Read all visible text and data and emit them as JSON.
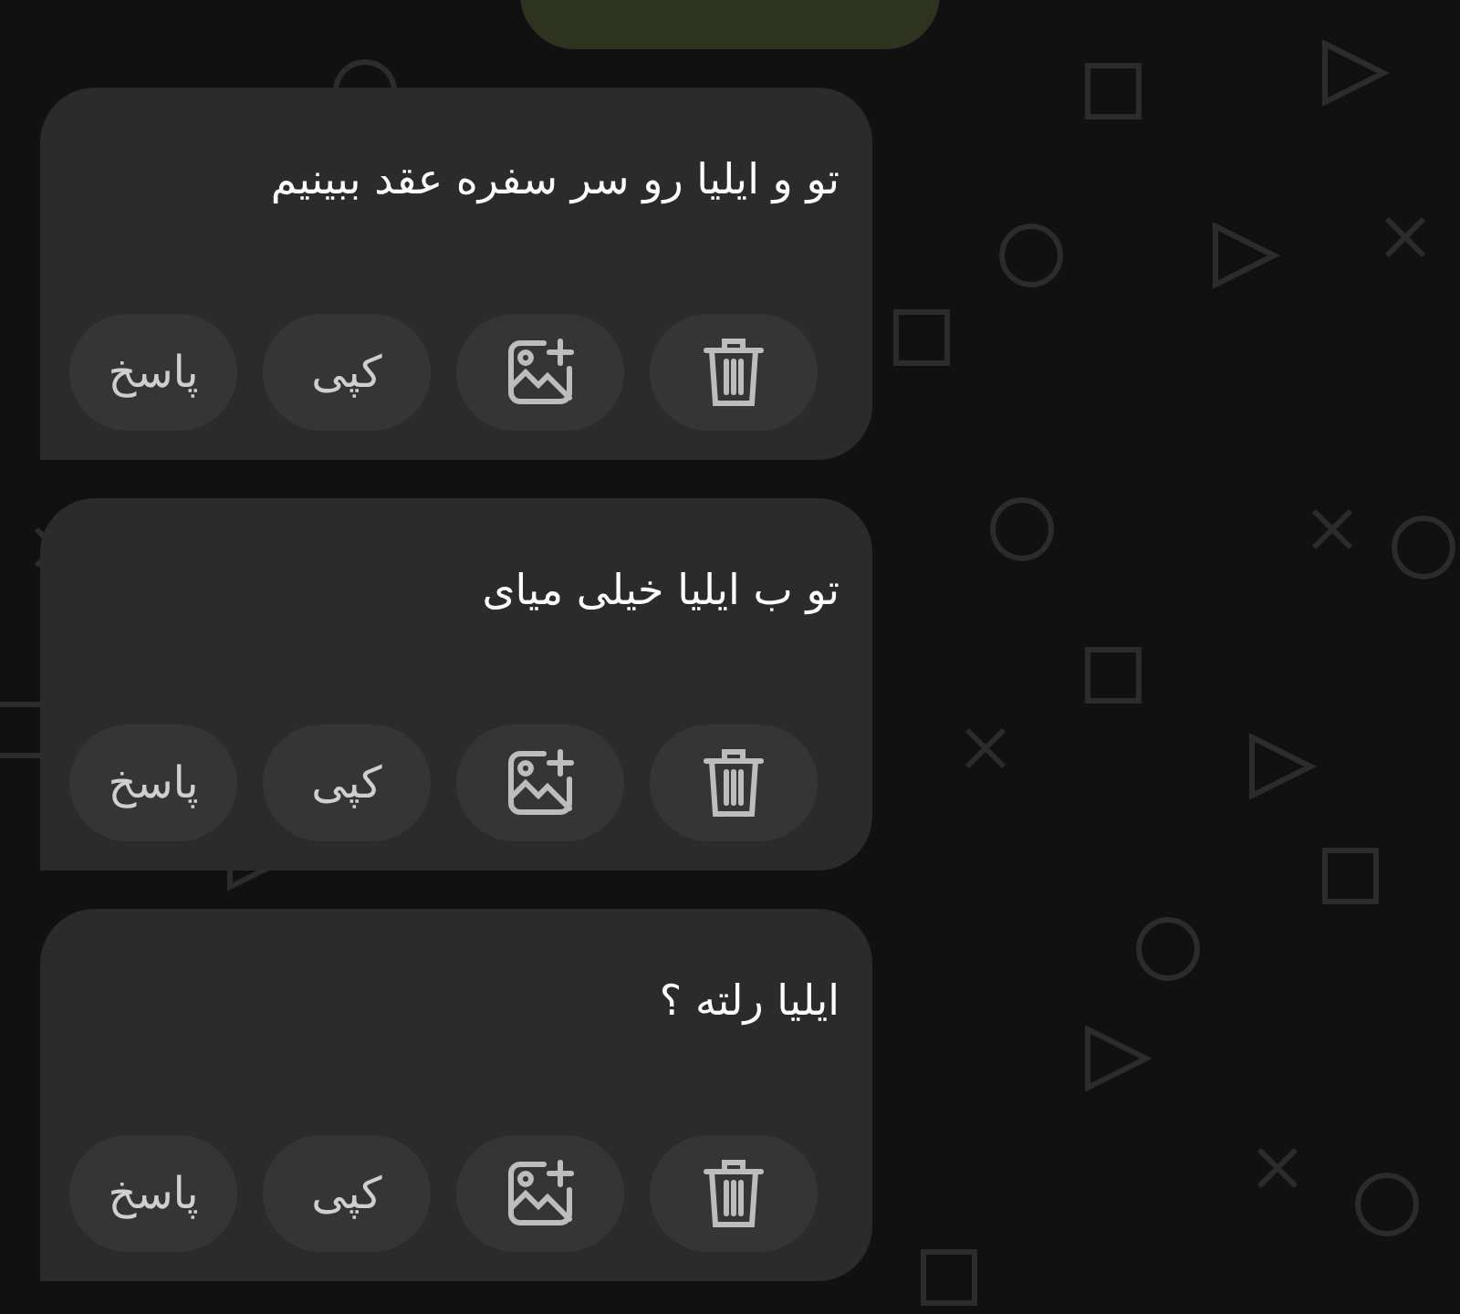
{
  "messages": [
    {
      "kind": "outgoing"
    },
    {
      "kind": "incoming",
      "text": "تو و ایلیا رو سر سفره عقد ببینیم",
      "actions": [
        {
          "kind": "delete"
        },
        {
          "kind": "image"
        },
        {
          "kind": "text",
          "label": "کپی"
        },
        {
          "kind": "text",
          "label": "پاسخ"
        }
      ]
    },
    {
      "kind": "incoming",
      "text": "تو ب ایلیا خیلی میای",
      "actions": [
        {
          "kind": "delete"
        },
        {
          "kind": "image"
        },
        {
          "kind": "text",
          "label": "کپی"
        },
        {
          "kind": "text",
          "label": "پاسخ"
        }
      ]
    },
    {
      "kind": "incoming",
      "text": "ایلیا رلته ؟",
      "actions": [
        {
          "kind": "delete"
        },
        {
          "kind": "image"
        },
        {
          "kind": "text",
          "label": "کپی"
        },
        {
          "kind": "text",
          "label": "پاسخ"
        }
      ]
    }
  ]
}
